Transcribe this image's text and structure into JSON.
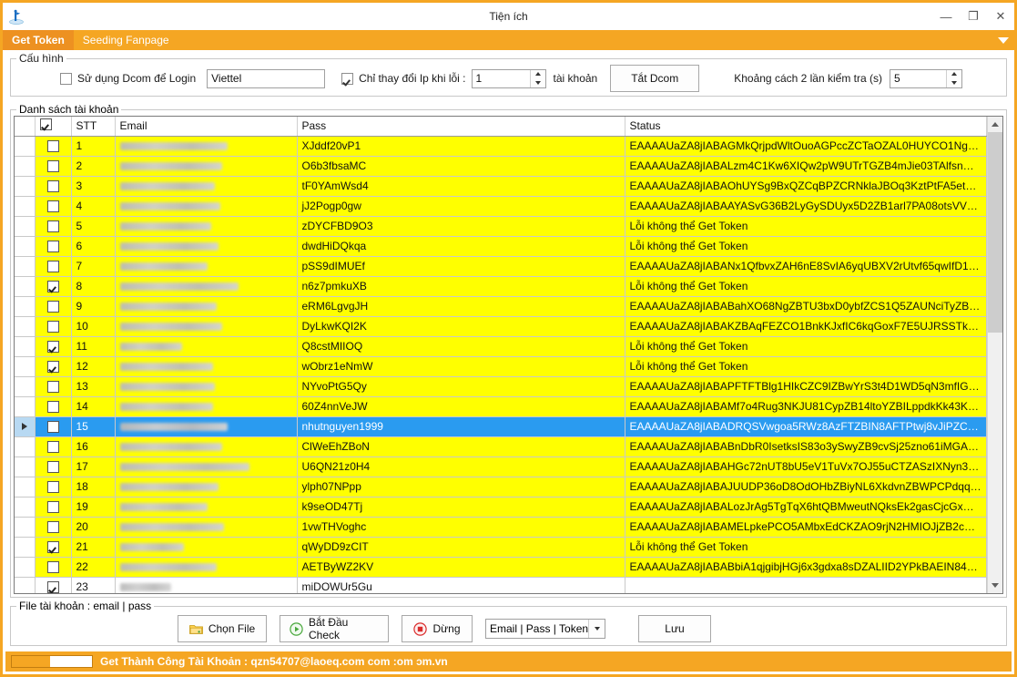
{
  "window": {
    "title": "Tiện ích",
    "app_icon": "app-icon",
    "minimize_glyph": "—",
    "maximize_glyph": "❐",
    "close_glyph": "✕",
    "accent_color": "#f5a623",
    "tab_active_color": "#ed9121"
  },
  "tabs": [
    {
      "label": "Get Token",
      "active": true
    },
    {
      "label": "Seeding Fanpage",
      "active": false
    }
  ],
  "config": {
    "legend": "Cấu hình",
    "use_dcom_checkbox": {
      "label": "Sử dụng Dcom để Login",
      "checked": false
    },
    "dcom_textbox": {
      "value": "Viettel",
      "placeholder": ""
    },
    "change_ip_checkbox": {
      "label": "Chỉ thay đổi Ip khi lỗi :",
      "checked": true
    },
    "change_ip_spinner": {
      "value": "1"
    },
    "accounts_unit_label": "tài khoản",
    "turn_off_dcom_button": "Tắt Dcom",
    "interval_label": "Khoảng cách 2 lần kiểm tra (s)",
    "interval_spinner": {
      "value": "5"
    }
  },
  "grid": {
    "legend": "Danh sách tài khoản",
    "columns": [
      "",
      "",
      "STT",
      "Email",
      "Pass",
      "Status"
    ],
    "header_checkbox_checked": true,
    "scrollbar": {
      "thumb_percent": 45
    },
    "rows": [
      {
        "stt": "1",
        "checked": false,
        "email_redacted_width": 118,
        "pass": "XJddf20vP1",
        "status": "EAAAAUaZA8jIABAGMkQrjpdWltOuoAGPccZCTaOZAL0HUYCO1Ng2Z...",
        "row_style": "yellow",
        "selected": false
      },
      {
        "stt": "2",
        "checked": false,
        "email_redacted_width": 112,
        "pass": "O6b3fbsaMC",
        "status": "EAAAAUaZA8jIABALzm4C1Kw6XIQw2pW9UTrTGZB4mJie03TAlfsnRW4...",
        "row_style": "yellow",
        "selected": false
      },
      {
        "stt": "3",
        "checked": false,
        "email_redacted_width": 104,
        "pass": "tF0YAmWsd4",
        "status": "EAAAAUaZA8jIABAOhUYSg9BxQZCqBPZCRNklaJBOq3KztPtFA5etMZB...",
        "row_style": "yellow",
        "selected": false
      },
      {
        "stt": "4",
        "checked": false,
        "email_redacted_width": 110,
        "pass": "jJ2Pogp0gw",
        "status": "EAAAAUaZA8jIABAAYASvG36B2LyGySDUyx5D2ZB1arl7PA08otsVVMT...",
        "row_style": "yellow",
        "selected": false
      },
      {
        "stt": "5",
        "checked": false,
        "email_redacted_width": 100,
        "pass": "zDYCFBD9O3",
        "status": "Lỗi không thể Get Token",
        "row_style": "yellow",
        "selected": false
      },
      {
        "stt": "6",
        "checked": false,
        "email_redacted_width": 108,
        "pass": "dwdHiDQkqa",
        "status": "Lỗi không thể Get Token",
        "row_style": "yellow",
        "selected": false
      },
      {
        "stt": "7",
        "checked": false,
        "email_redacted_width": 96,
        "pass": "pSS9dIMUEf",
        "status": "EAAAAUaZA8jIABANx1QfbvxZAH6nE8SvIA6yqUBXV2rUtvf65qwIfD1tx0...",
        "row_style": "yellow",
        "selected": false
      },
      {
        "stt": "8",
        "checked": true,
        "email_redacted_width": 130,
        "pass": "n6z7pmkuXB",
        "status": "Lỗi không thể Get Token",
        "row_style": "yellow",
        "selected": false
      },
      {
        "stt": "9",
        "checked": false,
        "email_redacted_width": 106,
        "pass": "eRM6LgvgJH",
        "status": "EAAAAUaZA8jIABABahXO68NgZBTU3bxD0ybfZCS1Q5ZAUNciTyZB2m...",
        "row_style": "yellow",
        "selected": false
      },
      {
        "stt": "10",
        "checked": false,
        "email_redacted_width": 112,
        "pass": "DyLkwKQI2K",
        "status": "EAAAAUaZA8jIABAKZBAqFEZCO1BnkKJxfIC6kqGoxF7E5UJRSSTk2Vx...",
        "row_style": "yellow",
        "selected": false
      },
      {
        "stt": "11",
        "checked": true,
        "email_redacted_width": 68,
        "pass": "Q8cstMIIOQ",
        "status": "Lỗi không thể Get Token",
        "row_style": "yellow",
        "selected": false
      },
      {
        "stt": "12",
        "checked": true,
        "email_redacted_width": 102,
        "pass": "wObrz1eNmW",
        "status": "Lỗi không thể Get Token",
        "row_style": "yellow",
        "selected": false
      },
      {
        "stt": "13",
        "checked": false,
        "email_redacted_width": 104,
        "pass": "NYvoPtG5Qy",
        "status": "EAAAAUaZA8jIABAPFTFTBlg1HIkCZC9IZBwYrS3t4D1WD5qN3mfIGZC...",
        "row_style": "yellow",
        "selected": false
      },
      {
        "stt": "14",
        "checked": false,
        "email_redacted_width": 102,
        "pass": "60Z4nnVeJW",
        "status": "EAAAAUaZA8jIABAMf7o4Rug3NKJU81CypZB14ltoYZBILppdkKk43Kp5...",
        "row_style": "yellow",
        "selected": false
      },
      {
        "stt": "15",
        "checked": false,
        "email_redacted_width": 118,
        "pass": "nhutnguyen1999",
        "status": "EAAAAUaZA8jIABADRQSVwgoa5RWz8AzFTZBIN8AFTPtwj8vJiPZCFFk...",
        "row_style": "yellow",
        "selected": true
      },
      {
        "stt": "16",
        "checked": false,
        "email_redacted_width": 112,
        "pass": "ClWeEhZBoN",
        "status": "EAAAAUaZA8jIABABnDbR0IsetksIS83o3ySwyZB9cvSj25zno61iMGAILm...",
        "row_style": "yellow",
        "selected": false
      },
      {
        "stt": "17",
        "checked": false,
        "email_redacted_width": 142,
        "pass": "U6QN21z0H4",
        "status": "EAAAAUaZA8jIABAHGc72nUT8bU5eV1TuVx7OJ55uCTZASzIXNyn38ZC...",
        "row_style": "yellow",
        "selected": false
      },
      {
        "stt": "18",
        "checked": false,
        "email_redacted_width": 108,
        "pass": "ylph07NPpp",
        "status": "EAAAAUaZA8jIABAJUUDP36oD8OdOHbZBiyNL6XkdvnZBWPCPdqqlB...",
        "row_style": "yellow",
        "selected": false
      },
      {
        "stt": "19",
        "checked": false,
        "email_redacted_width": 96,
        "pass": "k9seOD47Tj",
        "status": "EAAAAUaZA8jIABALozJrAg5TgTqX6htQBMweutNQksEk2gasCjcGxG9Cl...",
        "row_style": "yellow",
        "selected": false
      },
      {
        "stt": "20",
        "checked": false,
        "email_redacted_width": 114,
        "pass": "1vwTHVoghc",
        "status": "EAAAAUaZA8jIABAMELpkePCO5AMbxEdCKZAO9rjN2HMIOJjZB2cBqY...",
        "row_style": "yellow",
        "selected": false
      },
      {
        "stt": "21",
        "checked": true,
        "email_redacted_width": 70,
        "pass": "qWyDD9zCIT",
        "status": "Lỗi không thể Get Token",
        "row_style": "yellow",
        "selected": false
      },
      {
        "stt": "22",
        "checked": false,
        "email_redacted_width": 106,
        "pass": "AETByWZ2KV",
        "status": "EAAAAUaZA8jIABABbiA1qjgibjHGj6x3gdxa8sDZALIID2YPkBAEIN84orqw...",
        "row_style": "yellow",
        "selected": false
      },
      {
        "stt": "23",
        "checked": true,
        "email_redacted_width": 56,
        "pass": "miDOWUr5Gu",
        "status": "",
        "row_style": "white",
        "selected": false
      }
    ]
  },
  "bottom": {
    "legend": "File tài khoản : email | pass",
    "choose_file_button": "Chọn File",
    "start_check_button": "Bắt Đầu Check",
    "stop_button": "Dừng",
    "format_combo": {
      "value": "Email | Pass | Token"
    },
    "save_button": "Lưu"
  },
  "statusbar": {
    "progress_percent": 48,
    "text": "Get Thành Công Tài Khoản : qzn54707@laoeq.com com :om ɔm.vn"
  }
}
